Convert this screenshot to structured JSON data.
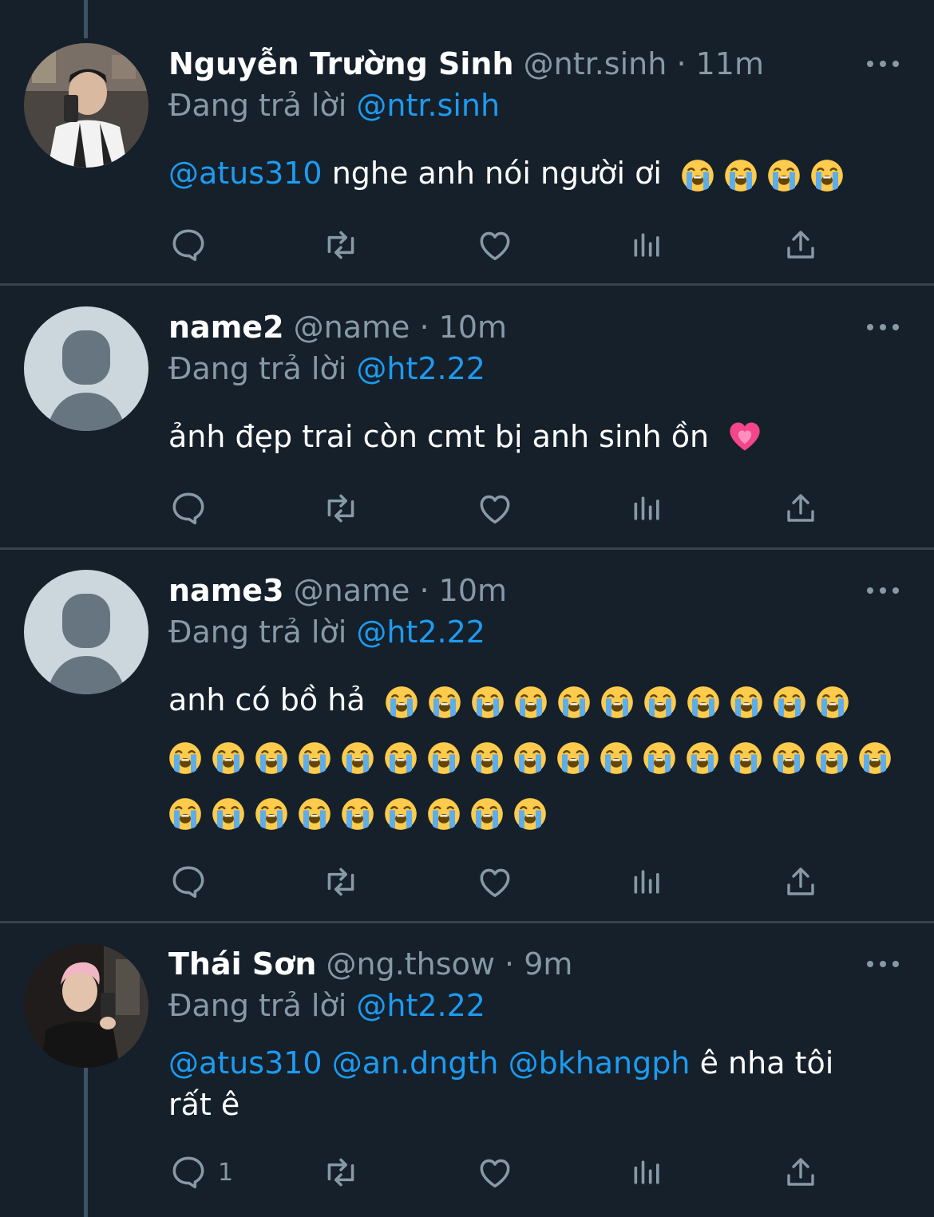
{
  "tweets": [
    {
      "name": "Nguyễn Trường Sinh",
      "handle": "@ntr.sinh",
      "separator": "·",
      "time": "11m",
      "reply_prefix": "Đang trả lời",
      "reply_to": "@ntr.sinh",
      "mentions": [
        "@atus310"
      ],
      "text": "nghe anh nói người ơi",
      "emoji": "loudly-crying-face",
      "emoji_count": 4,
      "avatar": "profile-photo",
      "reply_count": ""
    },
    {
      "name": "name2",
      "handle": "@name",
      "separator": "·",
      "time": "10m",
      "reply_prefix": "Đang trả lời",
      "reply_to": "@ht2.22",
      "text": "ảnh đẹp trai còn cmt bị anh sinh ồn",
      "emoji": "growing-heart",
      "avatar": "default-avatar",
      "reply_count": ""
    },
    {
      "name": "name3",
      "handle": "@name",
      "separator": "·",
      "time": "10m",
      "reply_prefix": "Đang trả lời",
      "reply_to": "@ht2.22",
      "text": "anh có bồ hả",
      "emoji": "loudly-crying-face",
      "emoji_rows": [
        11,
        17,
        9
      ],
      "avatar": "default-avatar",
      "reply_count": ""
    },
    {
      "name": "Thái Sơn",
      "handle": "@ng.thsow",
      "separator": "·",
      "time": "9m",
      "reply_prefix": "Đang trả lời",
      "reply_to": "@ht2.22",
      "mentions": [
        "@atus310",
        "@an.dngth",
        "@bkhangph"
      ],
      "text_line1": "ê nha tôi",
      "text_line2": "rất ê",
      "avatar": "profile-photo",
      "reply_count": "1"
    }
  ],
  "actions": [
    "reply-icon",
    "retweet-icon",
    "like-icon",
    "analytics-icon",
    "share-icon"
  ],
  "colors": {
    "background": "#15202b",
    "divider": "#38444d",
    "secondary_text": "#8899a6",
    "mention": "#1d9bf0",
    "thread_line": "#3d5466"
  }
}
